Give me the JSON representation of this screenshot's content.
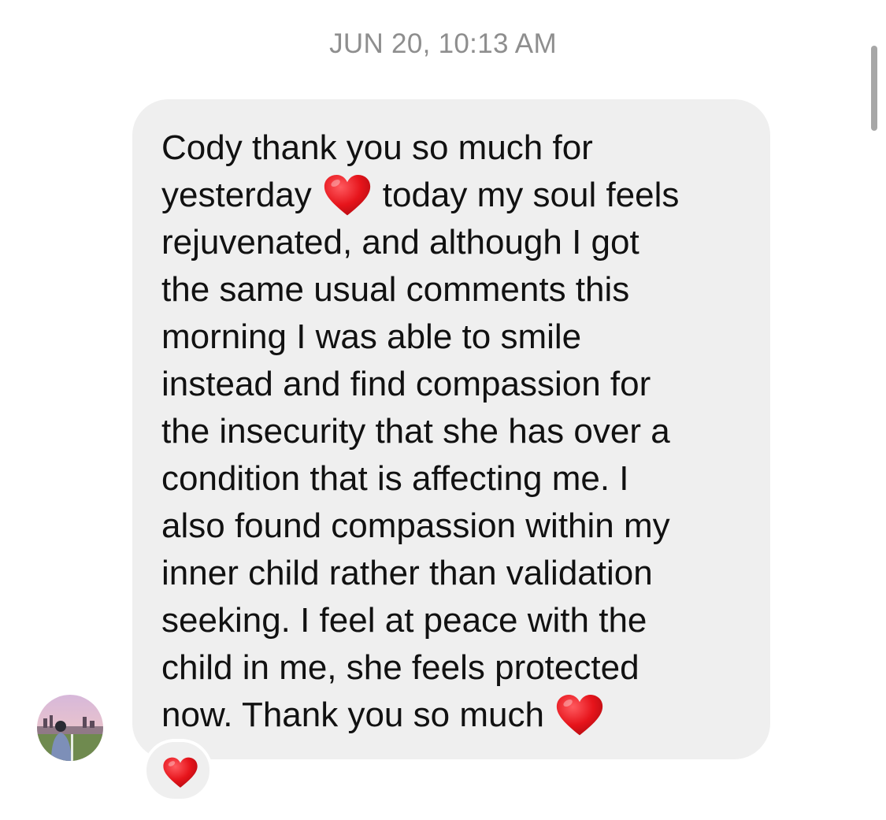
{
  "thread": {
    "timestamp": "JUN 20, 10:13 AM"
  },
  "message": {
    "lines": [
      "Cody thank you so much for",
      "yesterday",
      "today my soul feels",
      "rejuvenated, and although I got",
      "the same usual comments this",
      "morning I was able to smile",
      "instead and find compassion for",
      "the insecurity that she has over a",
      "condition that is affecting me. I",
      "also found compassion within my",
      "inner child rather than validation",
      "seeking. I feel at peace with the",
      "child in me, she feels protected",
      "now. Thank you so much"
    ],
    "inline_emoji": "red-heart",
    "reaction": "red-heart",
    "bubble_color": "#efefef",
    "text_color": "#111111",
    "heart_color": "#e6141b"
  },
  "sender": {
    "avatar": "profile-photo"
  }
}
